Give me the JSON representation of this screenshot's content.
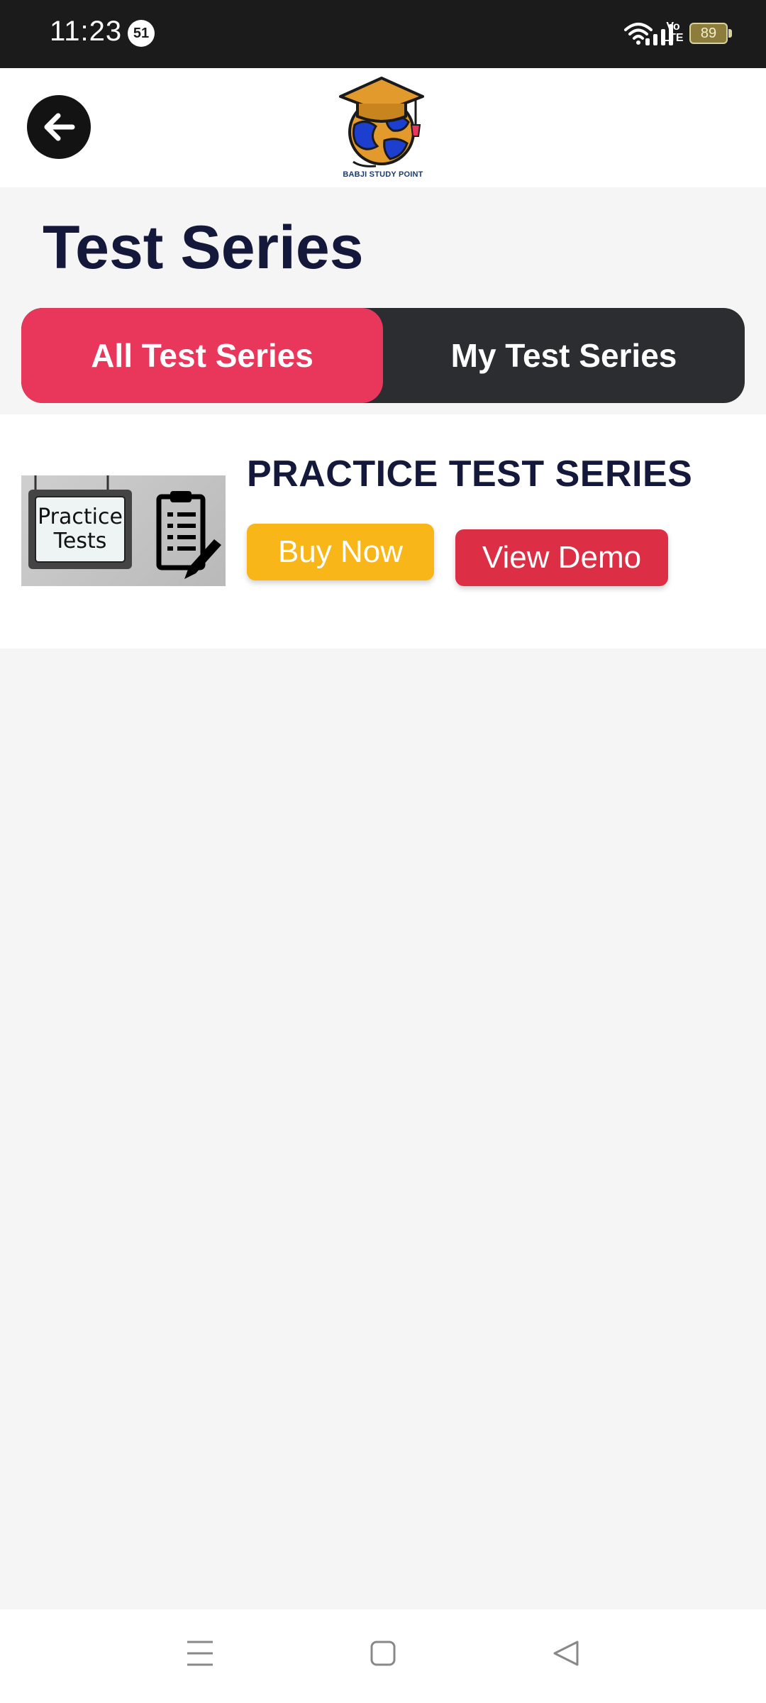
{
  "status_bar": {
    "time": "11:23",
    "notification_count": "51",
    "volte_top": "Vo",
    "volte_bottom": "LTE",
    "battery": "89"
  },
  "header": {
    "back_icon": "arrow-left-icon",
    "logo_text": "BABJI STUDY POINT"
  },
  "page": {
    "title": "Test Series"
  },
  "tabs": [
    {
      "label": "All Test Series",
      "active": true
    },
    {
      "label": "My Test Series",
      "active": false
    }
  ],
  "series": [
    {
      "thumb_line1": "Practice",
      "thumb_line2": "Tests",
      "title": "PRACTICE TEST SERIES",
      "buy_label": "Buy Now",
      "demo_label": "View Demo"
    }
  ],
  "nav": {
    "menu_icon": "menu-icon",
    "home_icon": "home-square-icon",
    "back_icon": "back-triangle-icon"
  },
  "colors": {
    "accent_tab": "#e8375a",
    "tab_bar": "#2b2d31",
    "buy": "#f8b619",
    "demo": "#dc2f46",
    "title": "#14183a"
  }
}
